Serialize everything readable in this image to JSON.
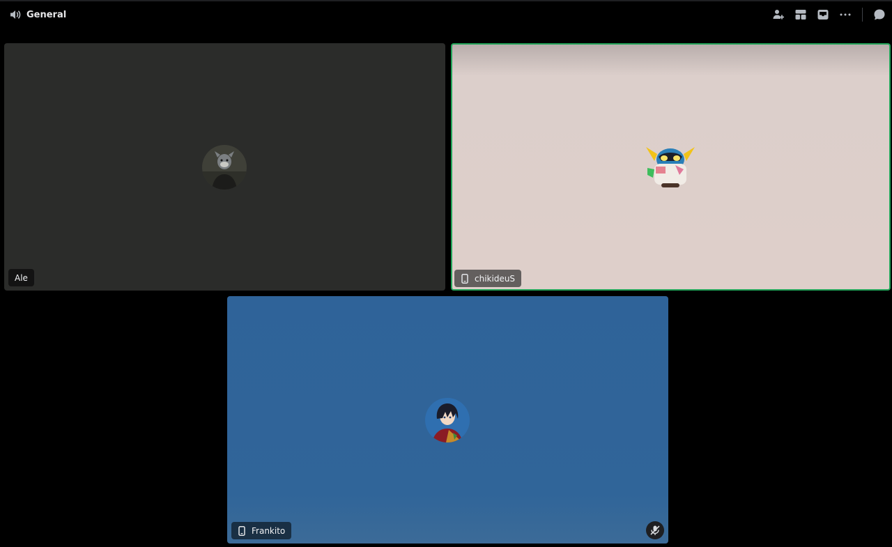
{
  "header": {
    "channel_icon": "speaker-icon",
    "channel_name": "General",
    "actions": [
      {
        "icon": "add-user-icon"
      },
      {
        "icon": "layout-grid-icon"
      },
      {
        "icon": "inbox-icon"
      },
      {
        "icon": "more-icon"
      },
      {
        "icon": "chat-bubble-icon"
      }
    ]
  },
  "participants": [
    {
      "name": "Ale",
      "device_icon": null,
      "background": "#2b2c2a",
      "speaking": false,
      "muted": false
    },
    {
      "name": "chikideuS",
      "device_icon": "mobile-phone-icon",
      "background": "#dccfcb",
      "speaking": true,
      "speaking_color": "#23a55a",
      "muted": false
    },
    {
      "name": "Frankito",
      "device_icon": "mobile-phone-icon",
      "background": "#306599",
      "speaking": false,
      "muted": true,
      "mute_icon": "mic-muted-icon"
    }
  ]
}
